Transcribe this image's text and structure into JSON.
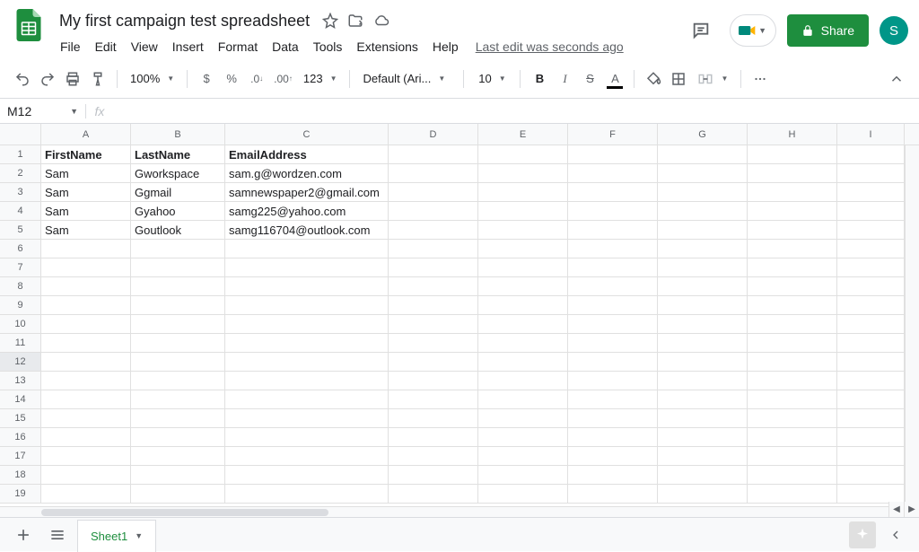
{
  "doc": {
    "title": "My first campaign test spreadsheet",
    "last_edit": "Last edit was seconds ago"
  },
  "menus": [
    "File",
    "Edit",
    "View",
    "Insert",
    "Format",
    "Data",
    "Tools",
    "Extensions",
    "Help"
  ],
  "share": {
    "label": "Share"
  },
  "avatar": {
    "initial": "S"
  },
  "toolbar": {
    "zoom": "100%",
    "font": "Default (Ari...",
    "size": "10",
    "more_formats": "123"
  },
  "namebox": "M12",
  "fx": "fx",
  "columns": [
    {
      "label": "A",
      "width": 100
    },
    {
      "label": "B",
      "width": 105
    },
    {
      "label": "C",
      "width": 182
    },
    {
      "label": "D",
      "width": 100
    },
    {
      "label": "E",
      "width": 100
    },
    {
      "label": "F",
      "width": 100
    },
    {
      "label": "G",
      "width": 100
    },
    {
      "label": "H",
      "width": 100
    },
    {
      "label": "I",
      "width": 75
    }
  ],
  "row_count": 19,
  "selected_row": 12,
  "cells": {
    "r1": {
      "A": "FirstName",
      "B": "LastName",
      "C": "EmailAddress",
      "bold": true
    },
    "r2": {
      "A": "Sam",
      "B": "Gworkspace",
      "C": "sam.g@wordzen.com"
    },
    "r3": {
      "A": "Sam",
      "B": "Ggmail",
      "C": "samnewspaper2@gmail.com"
    },
    "r4": {
      "A": "Sam",
      "B": "Gyahoo",
      "C": "samg225@yahoo.com"
    },
    "r5": {
      "A": "Sam",
      "B": "Goutlook",
      "C": "samg116704@outlook.com"
    }
  },
  "sheet": {
    "name": "Sheet1"
  }
}
